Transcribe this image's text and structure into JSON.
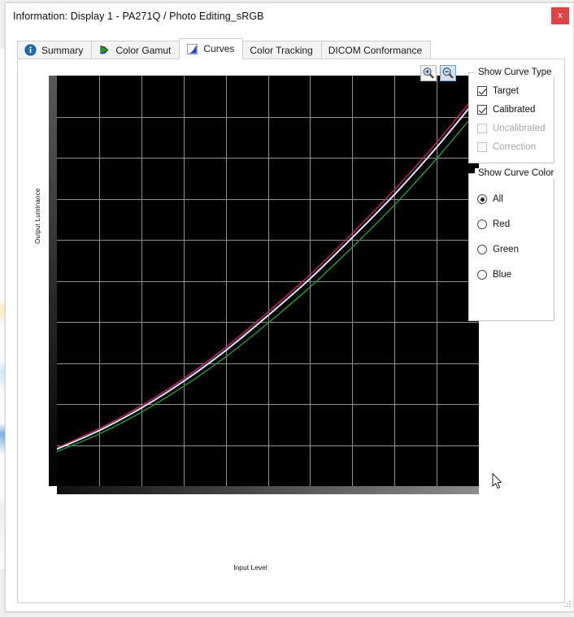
{
  "window": {
    "title": "Information: Display 1 - PA271Q / Photo Editing_sRGB",
    "close_label": "x"
  },
  "tabs": [
    {
      "label": "Summary",
      "icon": "info-icon",
      "active": false
    },
    {
      "label": "Color Gamut",
      "icon": "gamut-triangle-icon",
      "active": false
    },
    {
      "label": "Curves",
      "icon": "curves-chart-icon",
      "active": true
    },
    {
      "label": "Color Tracking",
      "icon": "none",
      "active": false
    },
    {
      "label": "DICOM Conformance",
      "icon": "none",
      "active": false
    }
  ],
  "toolbar": {
    "zoom_in_label": "zoom-in",
    "zoom_out_label": "zoom-out"
  },
  "curve_type_panel": {
    "title": "Show Curve Type",
    "items": [
      {
        "label": "Target",
        "checked": true,
        "enabled": true
      },
      {
        "label": "Calibrated",
        "checked": true,
        "enabled": true
      },
      {
        "label": "Uncalibrated",
        "checked": false,
        "enabled": false
      },
      {
        "label": "Correction",
        "checked": false,
        "enabled": false
      }
    ]
  },
  "curve_color_panel": {
    "title": "Show Curve Color",
    "selected": "All",
    "items": [
      {
        "label": "All",
        "selected": true
      },
      {
        "label": "Red",
        "selected": false
      },
      {
        "label": "Green",
        "selected": false
      },
      {
        "label": "Blue",
        "selected": false
      }
    ]
  },
  "chart_data": {
    "type": "line",
    "title": "",
    "xlabel": "Input Level",
    "ylabel": "Output Luminance",
    "xlim": [
      0,
      100
    ],
    "ylim": [
      0,
      100
    ],
    "grid": true,
    "grid_x_count": 10,
    "grid_y_count": 10,
    "background": "#000000",
    "legend_position": "none",
    "x": [
      0,
      10,
      20,
      30,
      40,
      50,
      60,
      70,
      80,
      90,
      100
    ],
    "series": [
      {
        "name": "Target",
        "color": "#ffffff",
        "values": [
          9.0,
          13.5,
          19.0,
          25.5,
          33.0,
          41.5,
          50.5,
          60.5,
          71.0,
          82.5,
          95.0
        ]
      },
      {
        "name": "Red",
        "color": "#d02828",
        "values": [
          9.3,
          14.0,
          19.6,
          26.2,
          33.8,
          42.4,
          51.5,
          61.6,
          72.2,
          83.7,
          96.3
        ]
      },
      {
        "name": "Green",
        "color": "#1f9e30",
        "values": [
          8.4,
          12.7,
          18.0,
          24.3,
          31.5,
          39.7,
          48.5,
          58.2,
          68.5,
          79.8,
          92.0
        ]
      },
      {
        "name": "Blue",
        "color": "#2a4fd8",
        "values": [
          9.1,
          13.7,
          19.2,
          25.8,
          33.3,
          41.8,
          50.8,
          60.8,
          71.3,
          82.8,
          95.3
        ]
      }
    ]
  },
  "gradients": {
    "vertical_label": "output-luminance-gradient",
    "horizontal_label": "input-level-gradient"
  }
}
